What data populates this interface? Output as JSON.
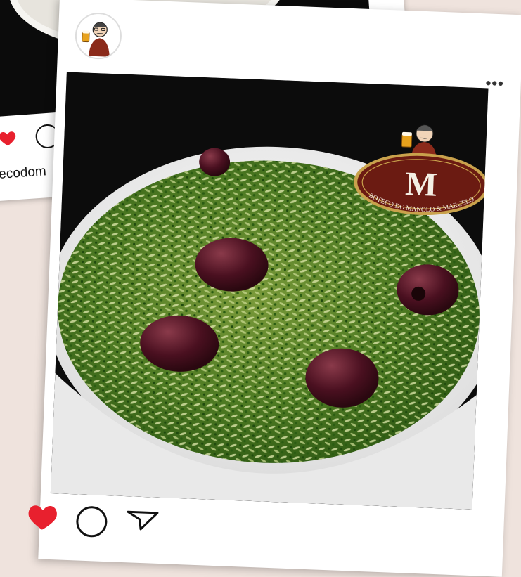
{
  "background_post": {
    "username": "ecodom",
    "like_icon": "heart-icon",
    "comment_icon": "comment-icon"
  },
  "main_post": {
    "avatar_icon": "avatar-chef",
    "more_icon": "more-dots-icon",
    "more_label": "•••",
    "photo_subject": "food-photo",
    "logo": {
      "letter": "M",
      "text": "BOTECO DO MANOLO & MARCELO",
      "colors": {
        "oval": "#6b1b12",
        "ring": "#c9a24c",
        "letter": "#f4efe4"
      }
    },
    "actions": {
      "like_icon": "heart-icon",
      "comment_icon": "comment-icon",
      "share_icon": "share-icon",
      "like_color": "#e8202e"
    }
  }
}
